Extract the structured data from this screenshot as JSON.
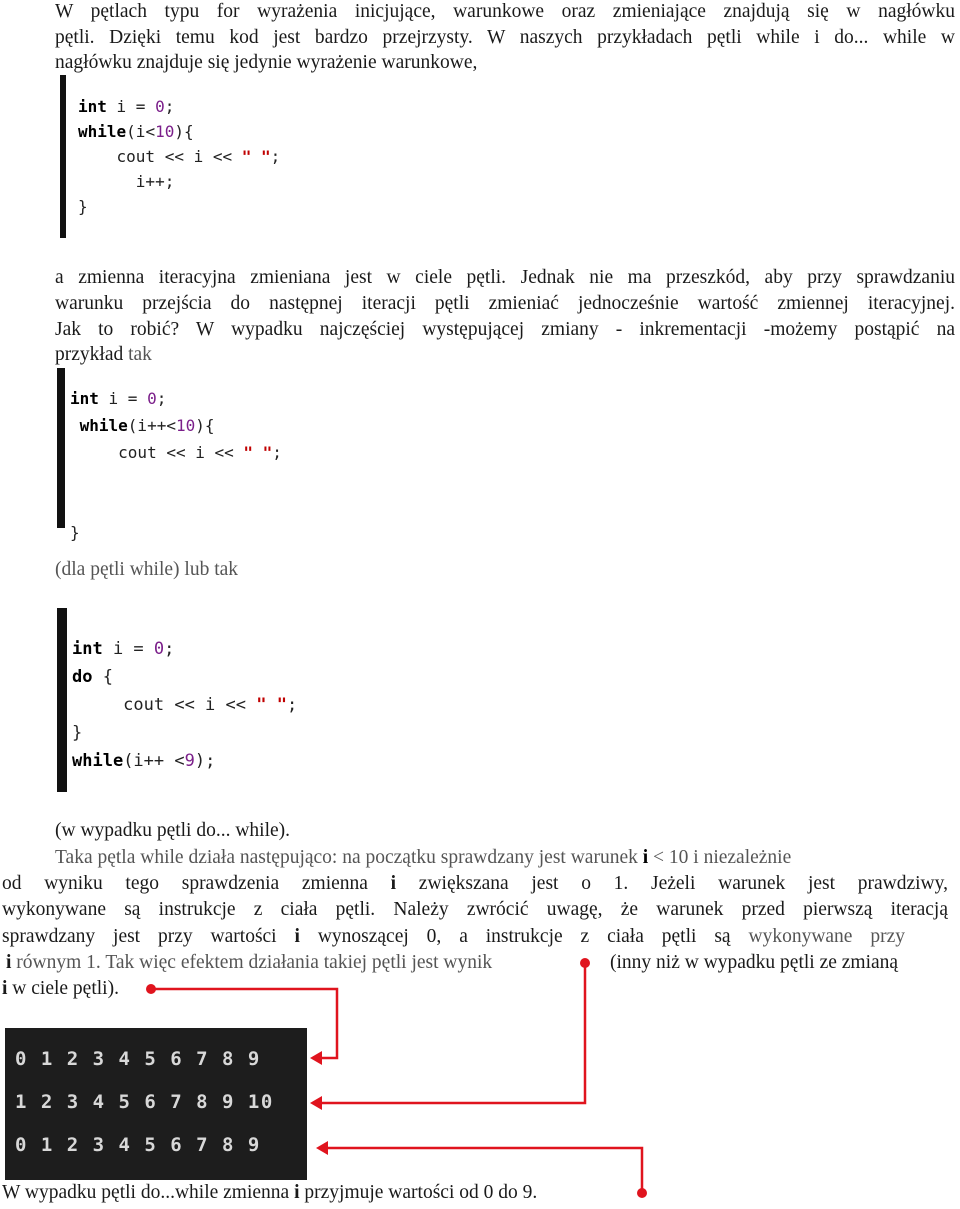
{
  "text": {
    "l0": "W pętlach typu for wyrażenia inicjujące, warunkowe oraz zmieniające znajdują się w nagłówku",
    "l1": "pętli. Dzięki temu kod jest bardzo przejrzysty. W naszych przykładach pętli while i do... while w",
    "l2": "nagłówku znajduje się jedynie wyrażenie warunkowe,",
    "l3": "a zmienna iteracyjna zmieniana jest w ciele pętli. Jednak nie ma przeszkód, aby przy sprawdzaniu",
    "l4": "warunku przejścia do następnej iteracji pętli zmieniać jednocześnie wartość zmiennej iteracyjnej.",
    "l5": "Jak to robić? W wypadku najczęściej występującej zmiany - inkrementacji -możemy postąpić na",
    "l6a": "przykład",
    "l6b": " tak",
    "l7": "(dla pętli while) lub tak",
    "l8": "(w wypadku pętli do... while).",
    "l9a": "Taka pętla while działa następująco: na początku sprawdzany jest warunek ",
    "l9b": "i",
    "l9c": " < 10 i niezależnie",
    "l10a": "od wyniku tego sprawdzenia zmienna ",
    "l10b": "i",
    "l10c": " zwiększana jest o 1. Jeżeli warunek jest prawdziwy,",
    "l11": "wykonywane są instrukcje z ciała pętli. Należy zwrócić uwagę, że warunek przed pierwszą iteracją",
    "l12a": "sprawdzany jest przy wartości ",
    "l12b": "i",
    "l12c": " wynoszącej 0, a instrukcje z ciała pętli są ",
    "l12d": "wykonywane przy",
    "l13a": "i",
    "l13b": " równym 1. Tak więc efektem działania takiej pętli jest wynik",
    "l13c": "(inny niż w wypadku pętli ze zmianą",
    "l14a": "i",
    "l14b": "  w ciele pętli).",
    "l15a": "W wypadku pętli do...while zmienna ",
    "l15b": "i",
    "l15c": " przyjmuje wartości od 0 do 9."
  },
  "code_blocks": [
    [
      [
        [
          "int",
          "kw"
        ],
        [
          " i = ",
          ""
        ],
        [
          "0",
          "num"
        ],
        [
          ";",
          ""
        ]
      ],
      [
        [
          "while",
          "kw"
        ],
        [
          "(i<",
          ""
        ],
        [
          "10",
          "num"
        ],
        [
          "){",
          ""
        ]
      ],
      [
        [
          "    cout << i << ",
          ""
        ],
        [
          "\" \"",
          "str"
        ],
        [
          ";",
          ""
        ]
      ],
      [
        [
          "      i++;",
          ""
        ]
      ],
      [
        [
          "}",
          ""
        ]
      ]
    ],
    [
      [
        [
          "int",
          "kw"
        ],
        [
          " i = ",
          ""
        ],
        [
          "0",
          "num"
        ],
        [
          ";",
          ""
        ]
      ],
      [
        [
          " while",
          "kw"
        ],
        [
          "(i++<",
          ""
        ],
        [
          "10",
          "num"
        ],
        [
          "){",
          ""
        ]
      ],
      [
        [
          "     cout << i << ",
          ""
        ],
        [
          "\" \"",
          "str"
        ],
        [
          ";",
          ""
        ]
      ],
      [
        [
          "",
          ""
        ]
      ],
      [
        [
          "}",
          ""
        ]
      ]
    ],
    [
      [
        [
          "int",
          "kw"
        ],
        [
          " i = ",
          ""
        ],
        [
          "0",
          "num"
        ],
        [
          ";",
          ""
        ]
      ],
      [
        [
          "do",
          "kw"
        ],
        [
          " {",
          ""
        ]
      ],
      [
        [
          "     cout << i << ",
          ""
        ],
        [
          "\" \"",
          "str"
        ],
        [
          ";",
          ""
        ]
      ],
      [
        [
          "}",
          ""
        ]
      ],
      [
        [
          "while",
          "kw"
        ],
        [
          "(i++ <",
          ""
        ],
        [
          "9",
          "num"
        ],
        [
          ");",
          ""
        ]
      ]
    ]
  ],
  "console_output": [
    "0 1 2 3 4 5 6 7 8 9",
    "1 2 3 4 5 6 7 8 9 10",
    "0 1 2 3 4 5 6 7 8 9"
  ],
  "colors": {
    "arrow": "#e0141e",
    "keyword_number": "#7b1f8a",
    "string": "#c00000",
    "console_bg": "#1d1d1d"
  }
}
